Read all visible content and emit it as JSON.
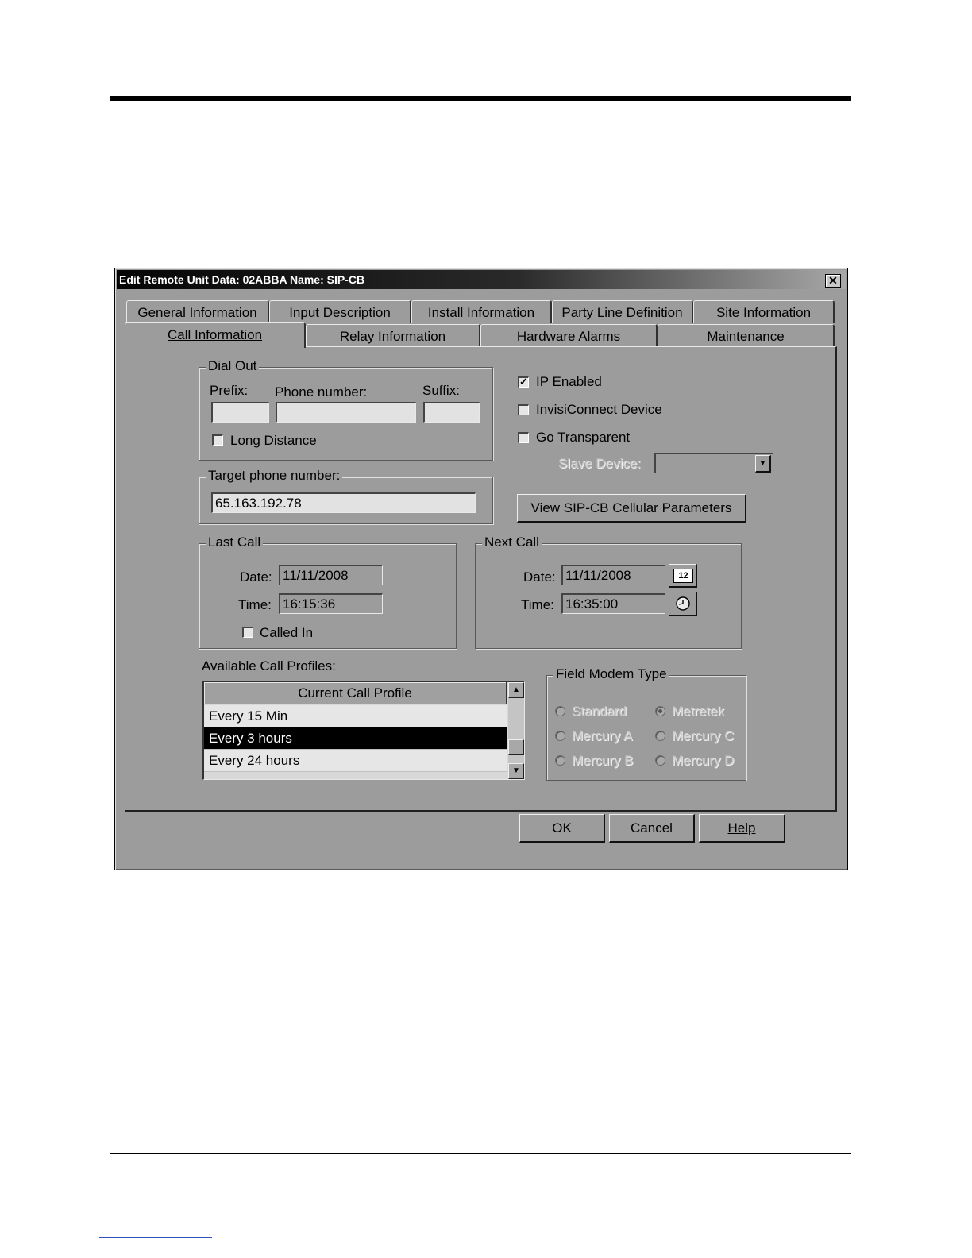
{
  "dialog": {
    "title": "Edit Remote Unit Data: 02ABBA  Name:  SIP-CB",
    "close_symbol": "✕"
  },
  "tabs_row1": [
    "General Information",
    "Input Description",
    "Install Information",
    "Party Line Definition",
    "Site Information"
  ],
  "tabs_row2": [
    "Call Information",
    "Relay Information",
    "Hardware Alarms",
    "Maintenance"
  ],
  "dial_out": {
    "legend": "Dial Out",
    "prefix_label": "Prefix:",
    "phone_label": "Phone number:",
    "suffix_label": "Suffix:",
    "prefix_value": "",
    "phone_value": "",
    "suffix_value": "",
    "long_distance_label": "Long Distance",
    "long_distance_checked": false
  },
  "target": {
    "legend": "Target phone number:",
    "value": "65.163.192.78"
  },
  "options": {
    "ip_enabled_label": "IP Enabled",
    "ip_enabled_checked": true,
    "invisiconnect_label": "InvisiConnect Device",
    "go_transparent_label": "Go Transparent",
    "slave_device_label": "Slave Device:",
    "slave_device_value": "",
    "view_params_button": "View SIP-CB Cellular Parameters"
  },
  "last_call": {
    "legend": "Last Call",
    "date_label": "Date:",
    "date_value": "11/11/2008",
    "time_label": "Time:",
    "time_value": "16:15:36",
    "called_in_label": "Called In"
  },
  "next_call": {
    "legend": "Next Call",
    "date_label": "Date:",
    "date_value": "11/11/2008",
    "time_label": "Time:",
    "time_value": "16:35:00",
    "calendar_icon_text": "12"
  },
  "profiles": {
    "label": "Available Call Profiles:",
    "header": "Current Call Profile",
    "items": [
      "Every 15 Min",
      "Every 3 hours",
      "Every 24 hours"
    ],
    "selected_index": 1
  },
  "field_modem": {
    "legend": "Field Modem Type",
    "options": [
      "Standard",
      "Metretek",
      "Mercury A",
      "Mercury C",
      "Mercury B",
      "Mercury D"
    ],
    "selected": "Metretek"
  },
  "buttons": {
    "ok": "OK",
    "cancel": "Cancel",
    "help": "Help"
  }
}
